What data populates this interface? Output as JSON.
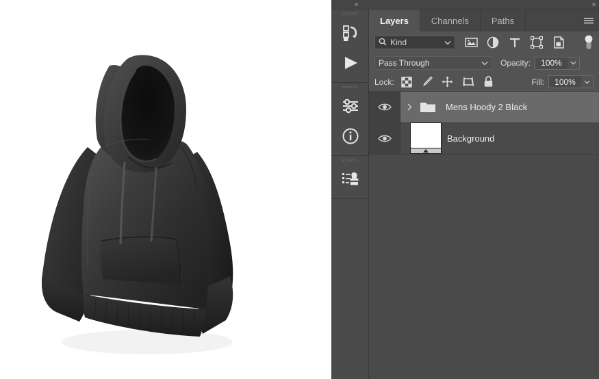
{
  "dock": {
    "collapse_left_icon": "double-chevron-left-icon",
    "collapse_right_icon": "double-chevron-right-icon"
  },
  "icon_rail": {
    "groups": [
      {
        "title": "CREATE",
        "items": [
          {
            "name": "batch-actions-icon",
            "label": "Batch Actions"
          },
          {
            "name": "play-run-icon",
            "label": "Run Action"
          }
        ]
      },
      {
        "title": "MANAGE",
        "items": [
          {
            "name": "sliders-settings-icon",
            "label": "Settings"
          },
          {
            "name": "info-circle-icon",
            "label": "Info"
          }
        ]
      },
      {
        "title": "ASSETS",
        "items": [
          {
            "name": "list-stamp-icon",
            "label": "Presets"
          }
        ]
      }
    ]
  },
  "panel": {
    "tabs": [
      {
        "label": "Layers",
        "active": true
      },
      {
        "label": "Channels",
        "active": false
      },
      {
        "label": "Paths",
        "active": false
      }
    ],
    "menu_icon": "hamburger-menu-icon",
    "filter": {
      "search_icon": "search-icon",
      "kind_value": "Kind",
      "dropdown_icon": "chevron-down-icon",
      "icons": [
        {
          "name": "filter-pixel-layers-icon",
          "label": "Filter for pixel layers"
        },
        {
          "name": "filter-adjustment-layers-icon",
          "label": "Filter for adjustment layers"
        },
        {
          "name": "filter-type-layers-icon",
          "label": "Filter for type layers"
        },
        {
          "name": "filter-shape-layers-icon",
          "label": "Filter for shape layers"
        },
        {
          "name": "filter-smart-object-layers-icon",
          "label": "Filter for smart objects"
        }
      ],
      "toggle_icon": "filter-toggle-switch-icon"
    },
    "blend": {
      "mode": "Pass Through",
      "mode_dropdown_icon": "chevron-down-icon",
      "opacity_label": "Opacity:",
      "opacity_value": "100%",
      "opacity_stepper_icon": "chevron-down-icon"
    },
    "lock": {
      "label": "Lock:",
      "icons": [
        {
          "name": "lock-transparent-pixels-icon",
          "label": "Lock transparent pixels"
        },
        {
          "name": "lock-image-pixels-icon",
          "label": "Lock image pixels"
        },
        {
          "name": "lock-position-icon",
          "label": "Lock position"
        },
        {
          "name": "lock-artboard-nesting-icon",
          "label": "Prevent auto-nesting"
        },
        {
          "name": "lock-all-icon",
          "label": "Lock all"
        }
      ],
      "fill_label": "Fill:",
      "fill_value": "100%",
      "fill_stepper_icon": "chevron-down-icon"
    },
    "layers": [
      {
        "name": "Mens Hoody 2 Black",
        "type": "group",
        "selected": true,
        "visible": true,
        "expanded": false,
        "eye_icon": "eye-visible-icon",
        "expand_icon": "chevron-right-icon",
        "thumb_icon": "folder-icon"
      },
      {
        "name": "Background",
        "type": "image",
        "selected": false,
        "visible": true,
        "eye_icon": "eye-visible-icon",
        "thumb_icon": "white-image-thumbnail"
      }
    ]
  },
  "canvas": {
    "artwork_name": "mens-black-hoodie-mockup",
    "background_color": "#ffffff"
  },
  "colors": {
    "panel_bg": "#535353",
    "tabbar_bg": "#454545",
    "list_bg": "#4a4a4a",
    "row_selected": "#6a6a6a",
    "text": "#ececec",
    "text_dim": "#b5b5b5",
    "field_bg": "#3b3b3b",
    "border": "#3f3f3f"
  }
}
